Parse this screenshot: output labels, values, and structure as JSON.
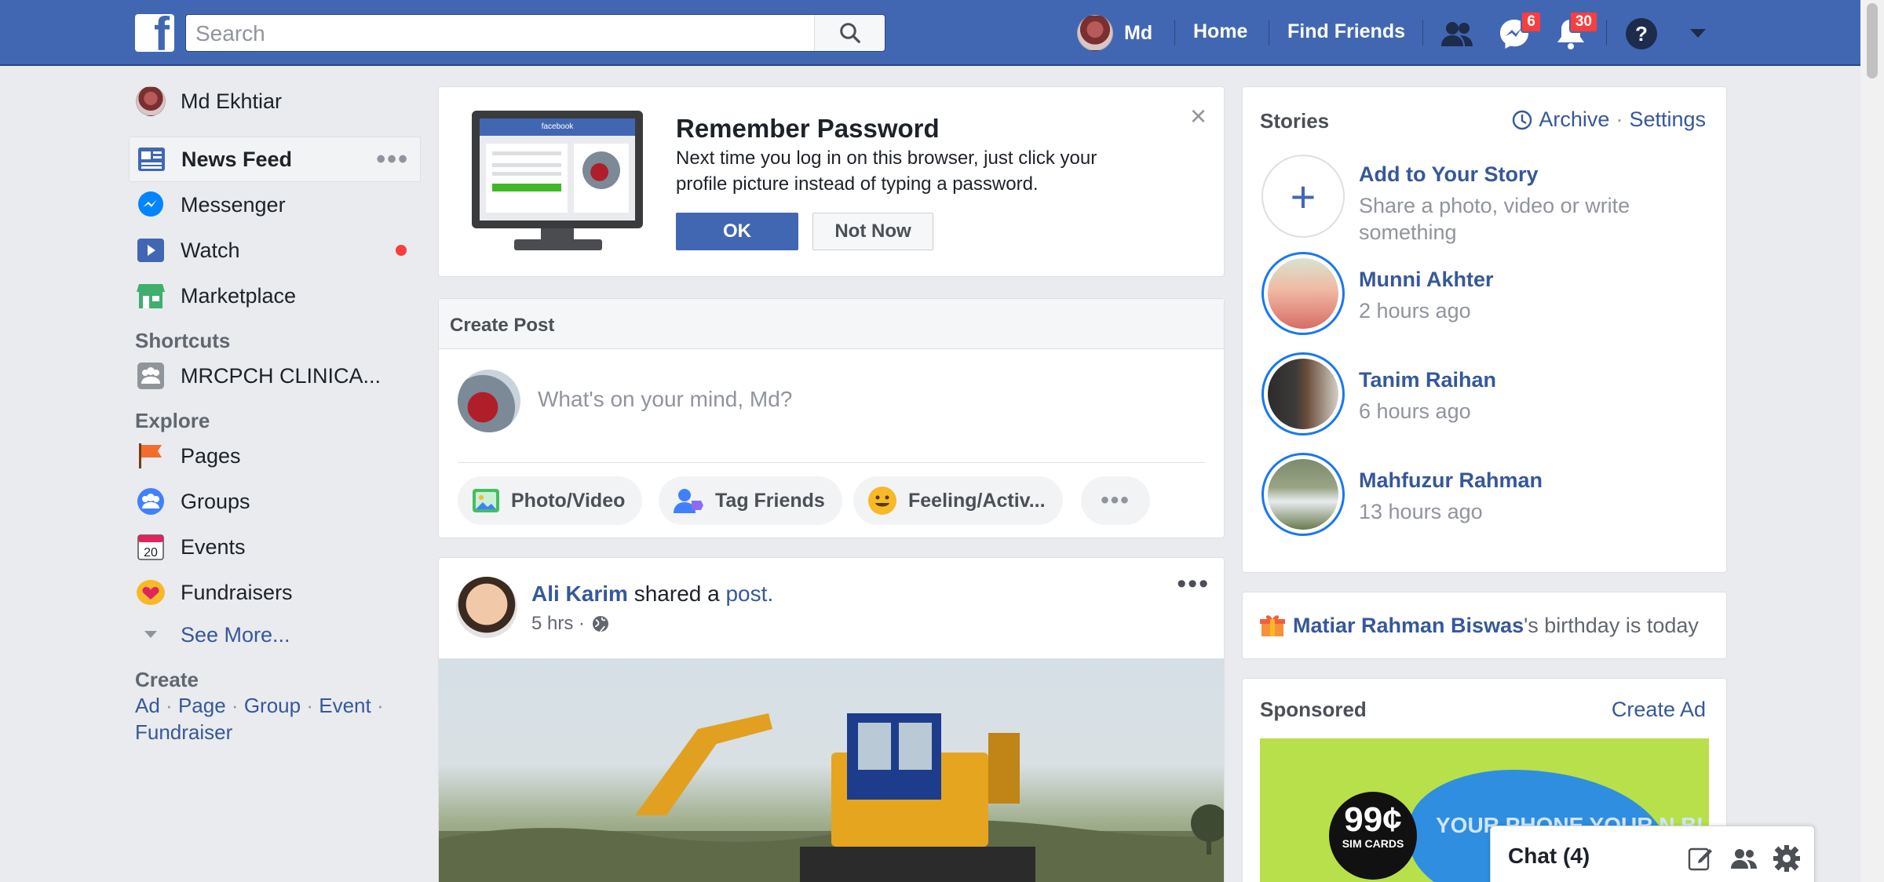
{
  "topbar": {
    "search_placeholder": "Search",
    "user_name": "Md",
    "home": "Home",
    "find_friends": "Find Friends",
    "messages_badge": "6",
    "notifications_badge": "30"
  },
  "left_nav": {
    "profile_name": "Md Ekhtiar",
    "items": [
      {
        "label": "News Feed"
      },
      {
        "label": "Messenger"
      },
      {
        "label": "Watch"
      },
      {
        "label": "Marketplace"
      }
    ],
    "shortcuts_title": "Shortcuts",
    "shortcut": "MRCPCH CLINICA...",
    "explore_title": "Explore",
    "explore": [
      {
        "label": "Pages"
      },
      {
        "label": "Groups"
      },
      {
        "label": "Events"
      },
      {
        "label": "Fundraisers"
      }
    ],
    "see_more": "See More...",
    "events_date": "20",
    "create_title": "Create",
    "create_links": [
      "Ad",
      "Page",
      "Group",
      "Event",
      "Fundraiser"
    ]
  },
  "password_card": {
    "title": "Remember Password",
    "text": "Next time you log in on this browser, just click your profile picture instead of typing a password.",
    "ok": "OK",
    "not_now": "Not Now",
    "monitor_label": "facebook"
  },
  "create_post": {
    "title": "Create Post",
    "placeholder": "What's on your mind, Md?",
    "photo_video": "Photo/Video",
    "tag_friends": "Tag Friends",
    "feeling": "Feeling/Activ..."
  },
  "post": {
    "author": "Ali Karim",
    "action": "shared a",
    "object": "post.",
    "time": "5 hrs ·"
  },
  "stories": {
    "title": "Stories",
    "archive": "Archive",
    "settings": "Settings",
    "add_title": "Add to Your Story",
    "add_sub": "Share a photo, video or write something",
    "items": [
      {
        "name": "Munni Akhter",
        "time": "2 hours ago"
      },
      {
        "name": "Tanim Raihan",
        "time": "6 hours ago"
      },
      {
        "name": "Mahfuzur Rahman",
        "time": "13 hours ago"
      }
    ]
  },
  "birthday": {
    "name": "Matiar Rahman Biswas",
    "suffix": "'s birthday is today"
  },
  "sponsored": {
    "title": "Sponsored",
    "create_ad": "Create Ad",
    "ad_price": "99¢",
    "ad_sim": "SIM CARDS",
    "ad_text": "YOUR PHONE YOUR N BI"
  },
  "chat": {
    "label": "Chat (4)"
  },
  "colors": {
    "brand": "#4267b2",
    "link": "#365899",
    "badge": "#fa3e3e",
    "background": "#e9ebee"
  }
}
